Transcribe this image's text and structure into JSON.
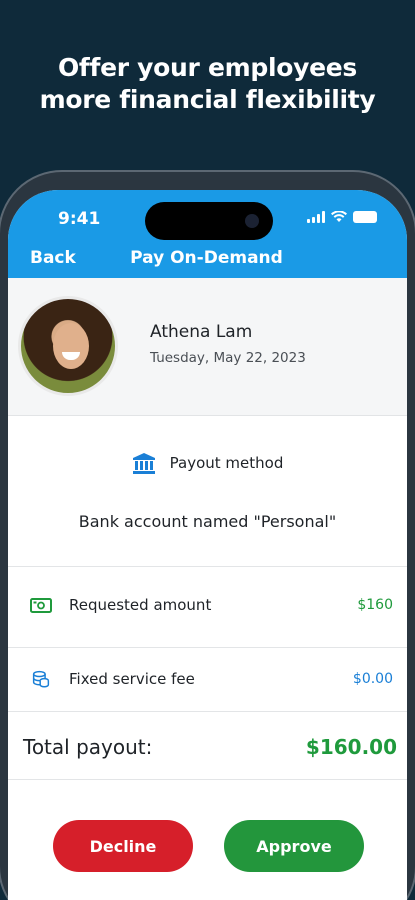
{
  "headline": {
    "line1": "Offer your employees",
    "line2": "more financial flexibility"
  },
  "status_bar": {
    "time": "9:41",
    "icons": [
      "signal-icon",
      "wifi-icon",
      "battery-icon"
    ]
  },
  "nav": {
    "back_label": "Back",
    "title": "Pay On-Demand"
  },
  "profile": {
    "name": "Athena Lam",
    "date": "Tuesday, May 22, 2023"
  },
  "payout": {
    "method_label": "Payout method",
    "method_icon": "bank-icon",
    "account": "Bank account named \"Personal\""
  },
  "line_items": [
    {
      "icon": "cash-icon",
      "label": "Requested amount",
      "amount": "$160",
      "color": "#1f9a3c"
    },
    {
      "icon": "coins-icon",
      "label": "Fixed service fee",
      "amount": "$0.00",
      "color": "#1a7fd6"
    }
  ],
  "total": {
    "label": "Total payout:",
    "amount": "$160.00"
  },
  "actions": {
    "decline_label": "Decline",
    "approve_label": "Approve"
  },
  "colors": {
    "background": "#0f2a3a",
    "brand_blue": "#1a9ae6",
    "green": "#1f9a3c",
    "red": "#d61f2a"
  }
}
